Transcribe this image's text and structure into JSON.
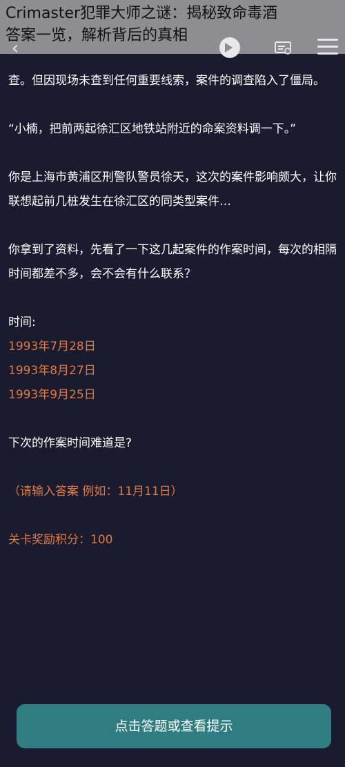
{
  "overlay": {
    "title_line1": "Crimaster犯罪大师之谜：揭秘致命毒酒",
    "title_line2": "答案一览，解析背后的真相"
  },
  "icons": {
    "back": "back-icon",
    "play": "play-icon",
    "ticket": "ticket-icon",
    "menu": "menu-icon"
  },
  "content": {
    "p1": "查。但因现场未查到任何重要线索，案件的调查陷入了僵局。",
    "p2": "“小楠，把前两起徐汇区地铁站附近的命案资料调一下。”",
    "p3": "你是上海市黄浦区刑警队警员徐天，这次的案件影响颇大，让你联想起前几桩发生在徐汇区的同类型案件…",
    "p4": "你拿到了资料，先看了一下这几起案件的作案时间，每次的相隔时间都差不多，会不会有什么联系？",
    "time_label": "时间:",
    "dates": [
      "1993年7月28日",
      "1993年8月27日",
      "1993年9月25日"
    ],
    "question": "下次的作案时间难道是?",
    "input_hint": "（请输入答案 例如：11月11日）",
    "reward": "关卡奖励积分：100"
  },
  "buttons": {
    "answer": "点击答题或查看提示"
  },
  "colors": {
    "background": "#1a1b2e",
    "accent_orange": "#e07a45",
    "button": "#2f7d80"
  }
}
